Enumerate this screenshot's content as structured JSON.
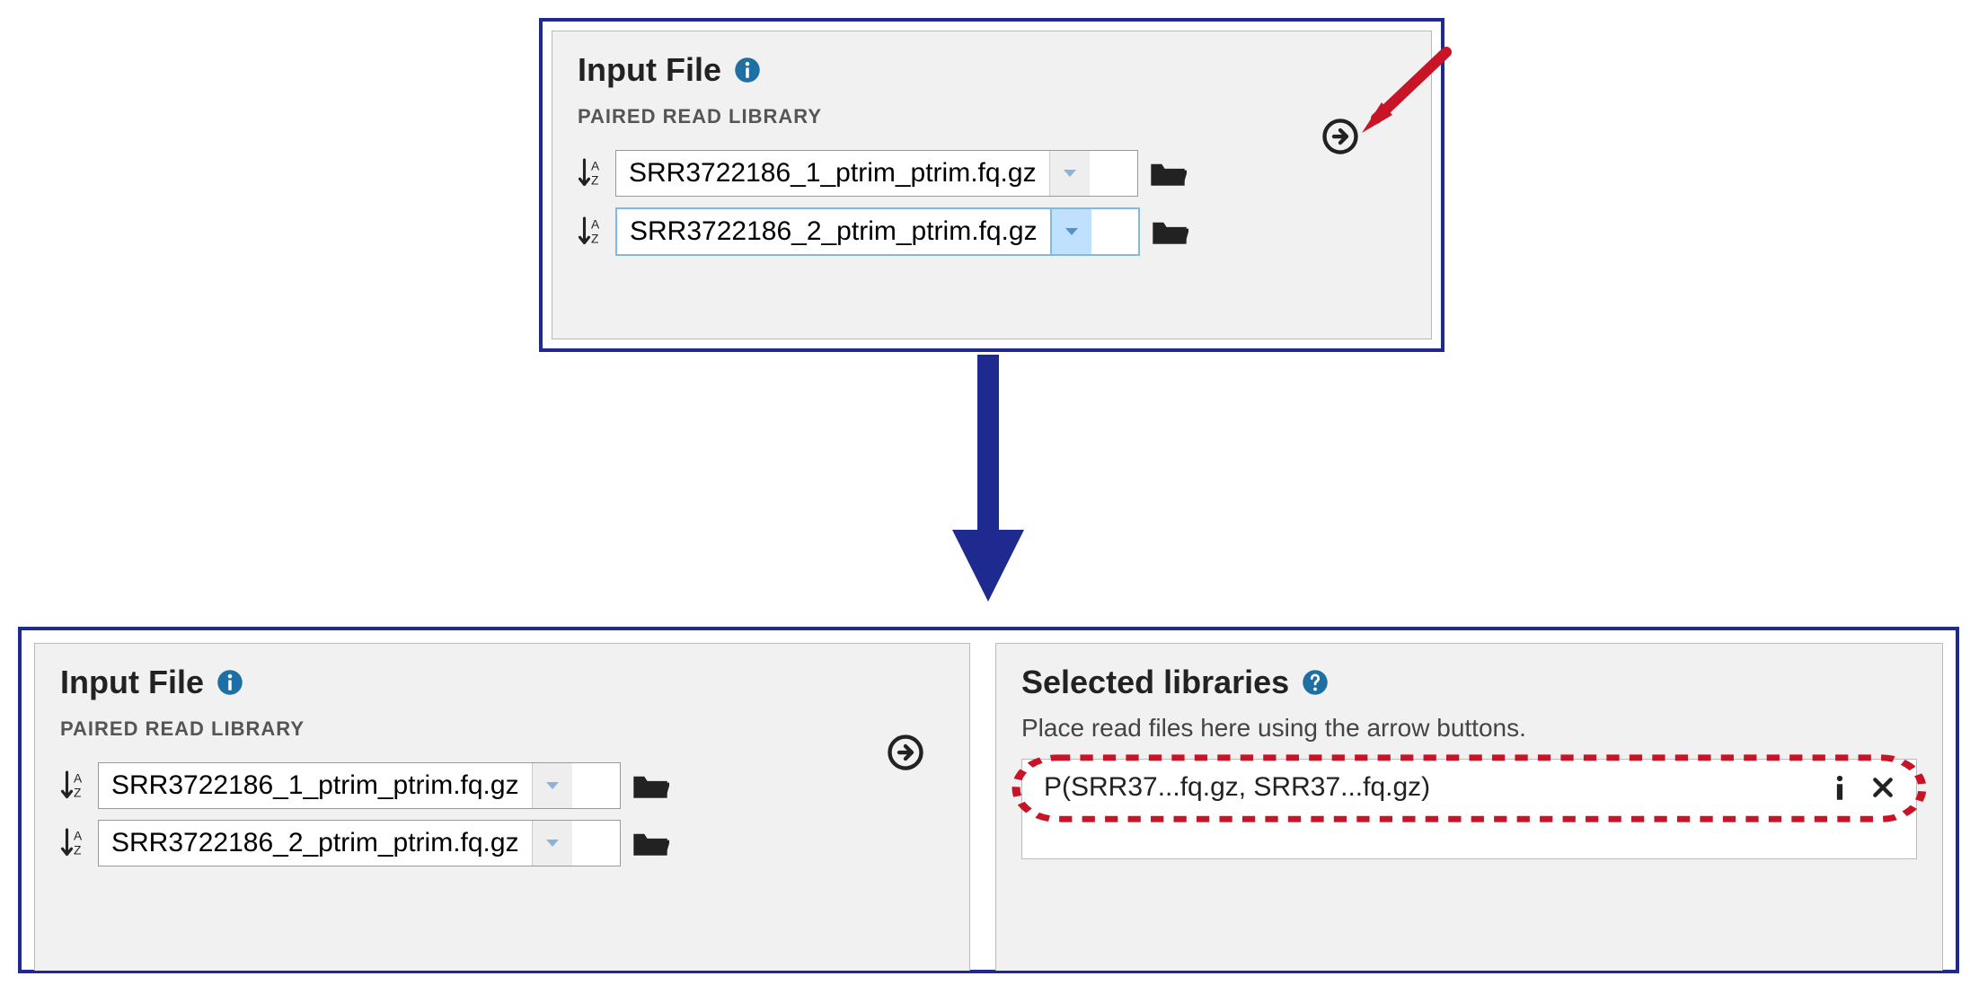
{
  "colors": {
    "panel_border": "#1e2a8f",
    "arrow": "#c81427",
    "dash": "#c81427",
    "info": "#1e6fa3"
  },
  "top_panel": {
    "title": "Input File",
    "subtitle": "PAIRED READ LIBRARY",
    "row1": {
      "value": "SRR3722186_1_ptrim_ptrim.fq.gz",
      "selected": false
    },
    "row2": {
      "value": "SRR3722186_2_ptrim_ptrim.fq.gz",
      "selected": true
    }
  },
  "bottom_left": {
    "title": "Input File",
    "subtitle": "PAIRED READ LIBRARY",
    "row1": {
      "value": "SRR3722186_1_ptrim_ptrim.fq.gz"
    },
    "row2": {
      "value": "SRR3722186_2_ptrim_ptrim.fq.gz"
    }
  },
  "bottom_right": {
    "title": "Selected libraries",
    "hint": "Place read files here using the arrow buttons.",
    "item": "P(SRR37...fq.gz, SRR37...fq.gz)"
  }
}
